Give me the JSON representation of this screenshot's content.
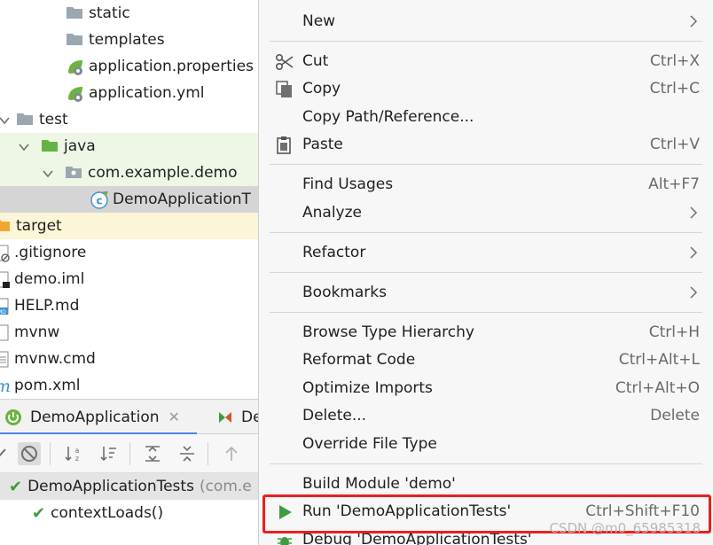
{
  "tree": {
    "rows": [
      {
        "label": "static",
        "icon": "folder-icon"
      },
      {
        "label": "templates",
        "icon": "folder-icon"
      },
      {
        "label": "application.properties",
        "icon": "spring-leaf-icon"
      },
      {
        "label": "application.yml",
        "icon": "spring-leaf-icon"
      },
      {
        "label": "test",
        "icon": "folder-icon"
      },
      {
        "label": "java",
        "icon": "test-folder-icon"
      },
      {
        "label": "com.example.demo",
        "icon": "package-icon"
      },
      {
        "label": "DemoApplicationT",
        "icon": "java-class-icon"
      },
      {
        "label": "target",
        "icon": "folder-icon"
      },
      {
        "label": ".gitignore",
        "icon": "ignore-file-icon"
      },
      {
        "label": "demo.iml",
        "icon": "iml-file-icon"
      },
      {
        "label": "HELP.md",
        "icon": "markdown-file-icon"
      },
      {
        "label": "mvnw",
        "icon": "text-file-icon"
      },
      {
        "label": "mvnw.cmd",
        "icon": "text-file-icon"
      },
      {
        "label": "pom.xml",
        "icon": "maven-icon"
      }
    ]
  },
  "run_tabs": {
    "active_label": "DemoApplication",
    "second_label": "De"
  },
  "results": {
    "root_label": "DemoApplicationTests",
    "root_suffix": "(com.e",
    "child_label": "contextLoads()"
  },
  "menu": {
    "new": "New",
    "cut": "Cut",
    "cut_shortcut": "Ctrl+X",
    "copy": "Copy",
    "copy_shortcut": "Ctrl+C",
    "copy_path": "Copy Path/Reference...",
    "paste": "Paste",
    "paste_shortcut": "Ctrl+V",
    "find_usages": "Find Usages",
    "find_usages_shortcut": "Alt+F7",
    "analyze": "Analyze",
    "refactor": "Refactor",
    "bookmarks": "Bookmarks",
    "browse_type": "Browse Type Hierarchy",
    "browse_type_shortcut": "Ctrl+H",
    "reformat": "Reformat Code",
    "reformat_shortcut": "Ctrl+Alt+L",
    "optimize": "Optimize Imports",
    "optimize_shortcut": "Ctrl+Alt+O",
    "delete": "Delete...",
    "delete_shortcut": "Delete",
    "override": "Override File Type",
    "build": "Build Module 'demo'",
    "run": "Run 'DemoApplicationTests'",
    "run_shortcut": "Ctrl+Shift+F10",
    "debug": "Debug 'DemoApplicationTests'"
  },
  "watermark": "CSDN @m0_65985318",
  "colors": {
    "menu_bg": "#f7f7f7",
    "highlight_box": "#e8211c",
    "test_pass": "#3e9c3e",
    "run_icon": "#3e9c3e",
    "folder": "#a9b7c6"
  }
}
